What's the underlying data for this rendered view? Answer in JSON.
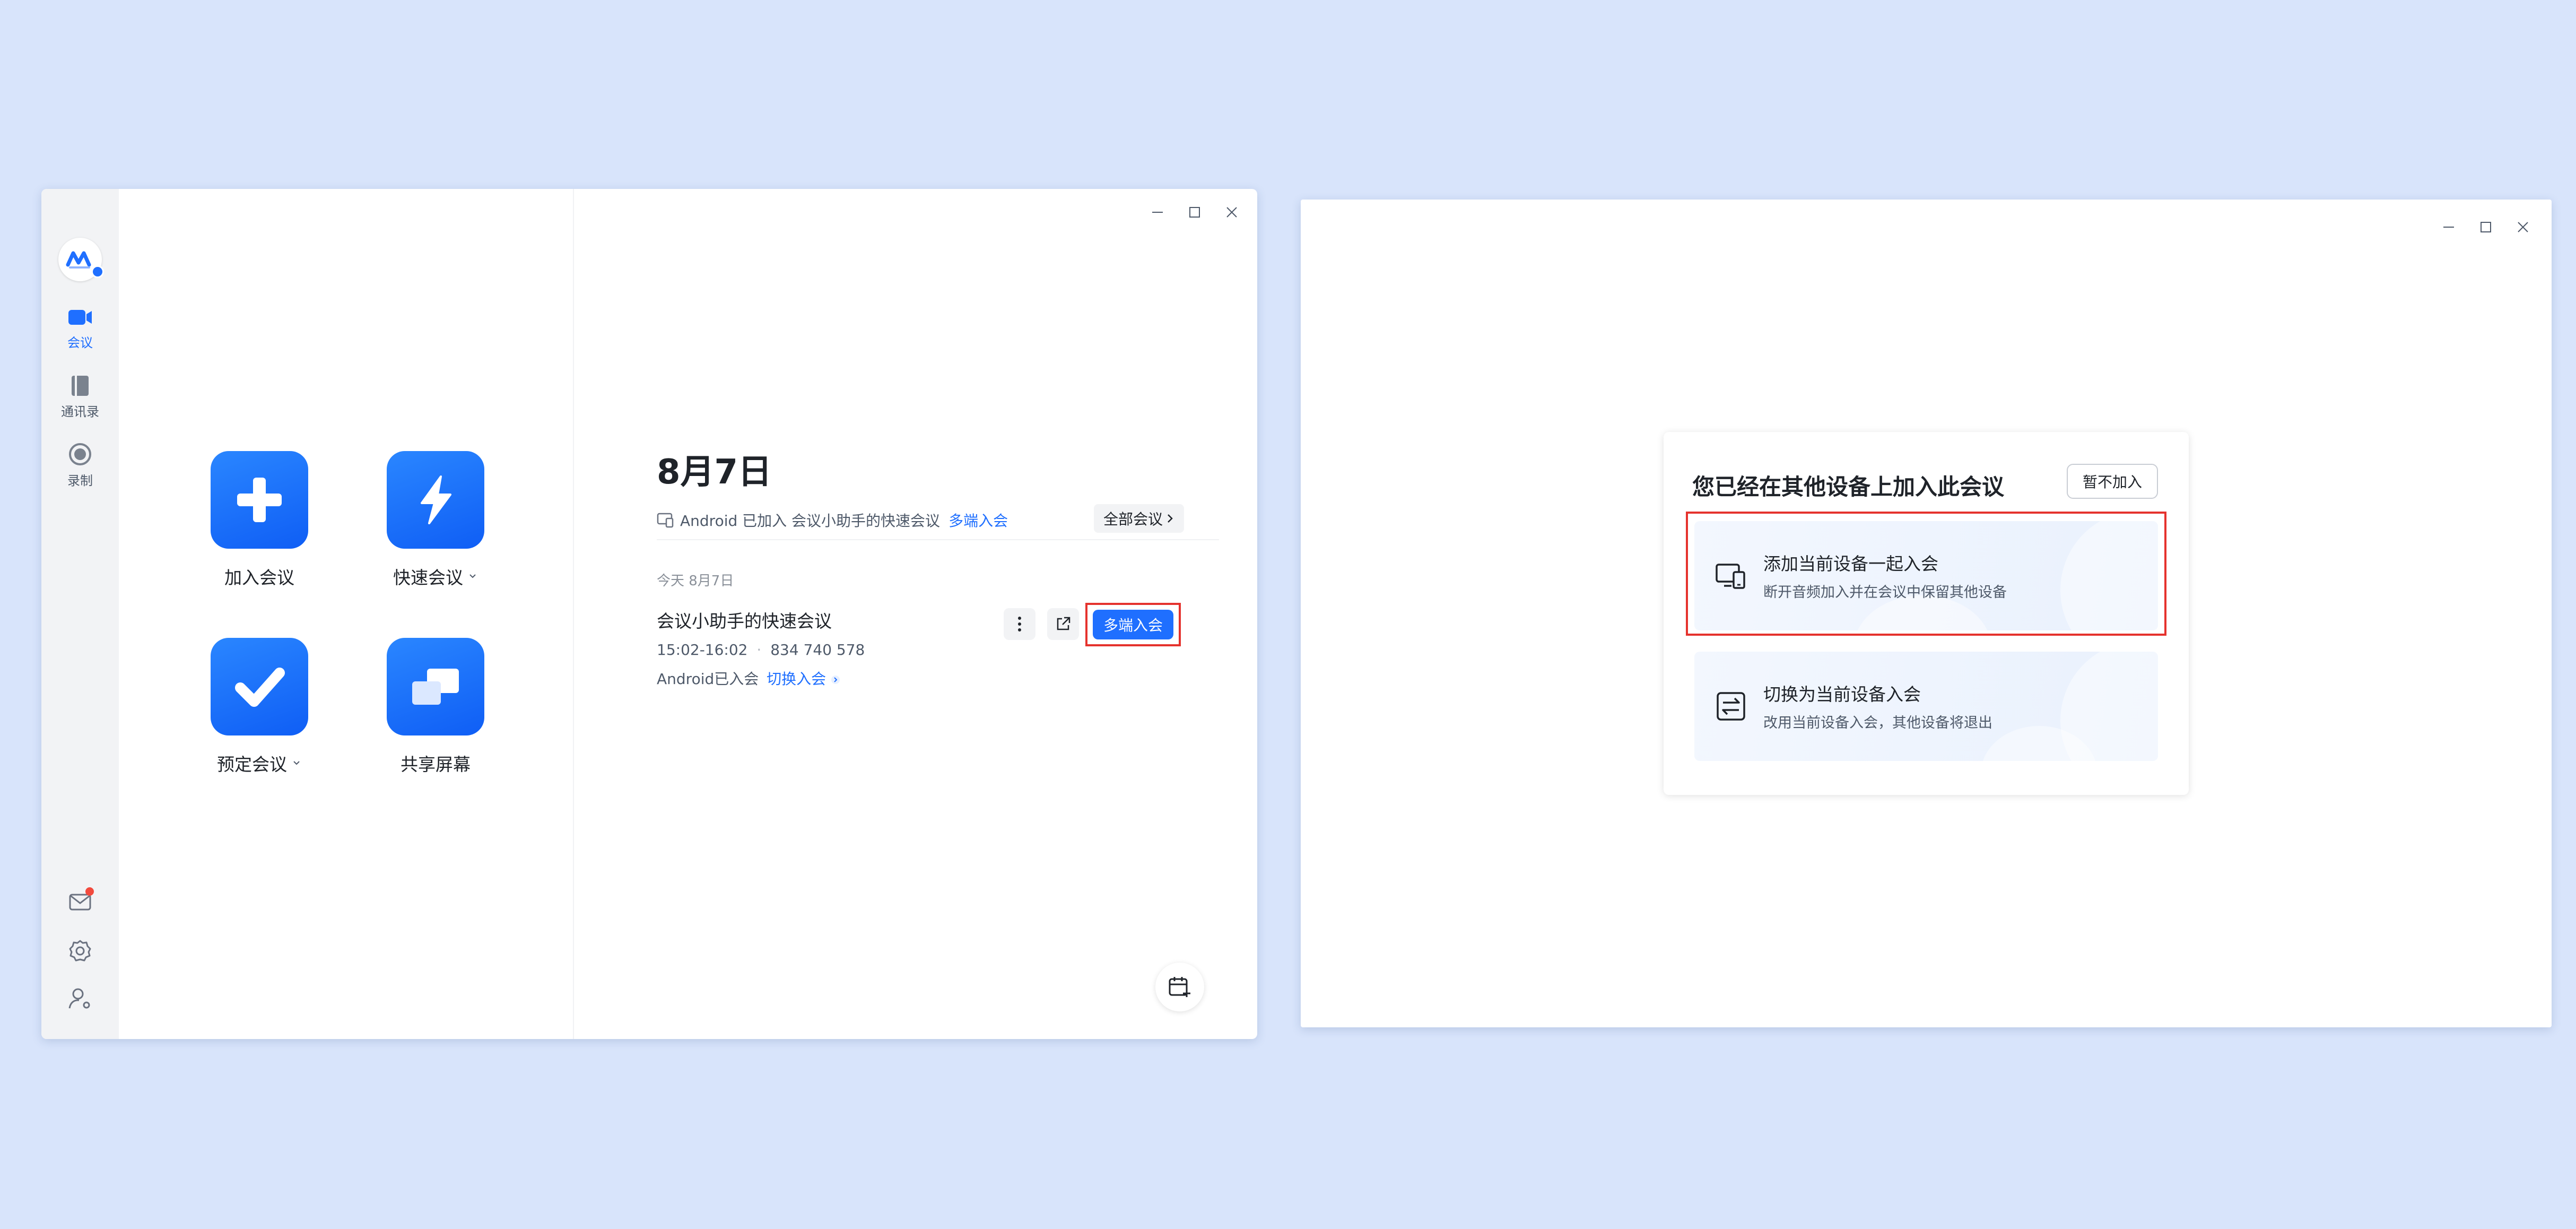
{
  "left_window": {
    "sidebar": {
      "items": [
        {
          "label": "会议",
          "icon": "video-icon",
          "active": true
        },
        {
          "label": "通讯录",
          "icon": "contacts-icon",
          "active": false
        },
        {
          "label": "录制",
          "icon": "record-icon",
          "active": false
        }
      ]
    },
    "actions": [
      {
        "label": "加入会议",
        "icon": "plus-icon",
        "dropdown": false
      },
      {
        "label": "快速会议",
        "icon": "lightning-icon",
        "dropdown": true
      },
      {
        "label": "预定会议",
        "icon": "check-icon",
        "dropdown": true
      },
      {
        "label": "共享屏幕",
        "icon": "screen-share-icon",
        "dropdown": false
      }
    ],
    "date_heading": "8月7日",
    "device_notice": {
      "text": "Android 已加入 会议小助手的快速会议",
      "link": "多端入会"
    },
    "all_meetings": "全部会议",
    "today_label": "今天 8月7日",
    "meeting": {
      "title": "会议小助手的快速会议",
      "time": "15:02-16:02",
      "separator": "·",
      "id": "834 740 578",
      "status": "Android已入会",
      "switch_link": "切换入会",
      "join_button": "多端入会"
    }
  },
  "right_window": {
    "dialog": {
      "title": "您已经在其他设备上加入此会议",
      "skip_button": "暂不加入",
      "options": [
        {
          "title": "添加当前设备一起入会",
          "desc": "断开音频加入并在会议中保留其他设备",
          "icon": "multi-device-icon"
        },
        {
          "title": "切换为当前设备入会",
          "desc": "改用当前设备入会，其他设备将退出",
          "icon": "switch-icon"
        }
      ]
    }
  },
  "colors": {
    "background": "#d8e4fb",
    "accent": "#1f6fff",
    "highlight": "#e5322d"
  }
}
